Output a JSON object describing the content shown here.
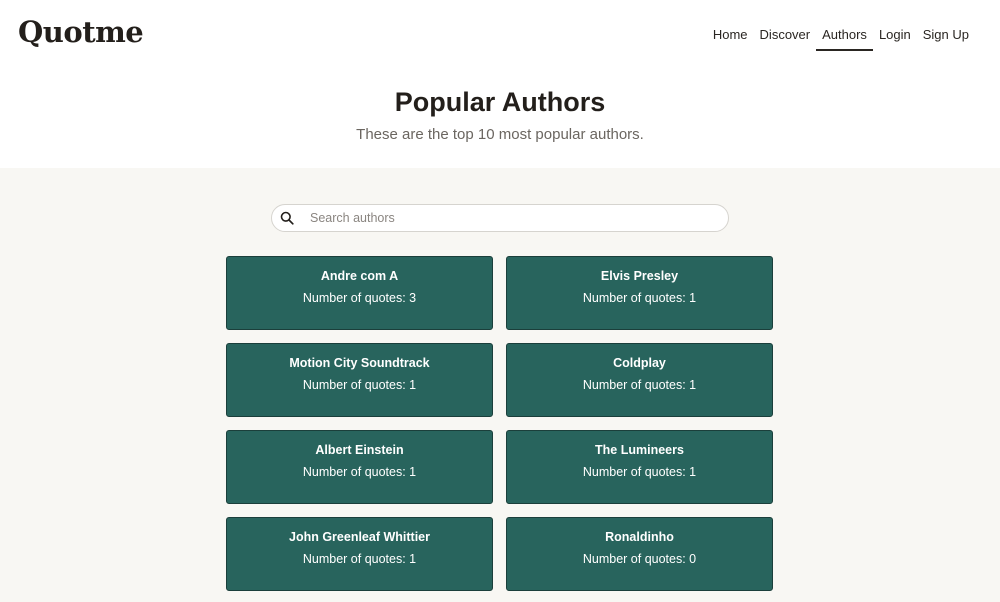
{
  "app": {
    "logo": "Quotme"
  },
  "nav": {
    "items": [
      "Home",
      "Discover",
      "Authors",
      "Login",
      "Sign Up"
    ],
    "active": "Authors"
  },
  "hero": {
    "title": "Popular Authors",
    "subtitle": "These are the top 10 most popular authors."
  },
  "search": {
    "placeholder": "Search authors",
    "value": ""
  },
  "authors": [
    {
      "name": "Andre com A",
      "count_text": "Number of quotes: 3"
    },
    {
      "name": "Elvis Presley",
      "count_text": "Number of quotes: 1"
    },
    {
      "name": "Motion City Soundtrack",
      "count_text": "Number of quotes: 1"
    },
    {
      "name": "Coldplay",
      "count_text": "Number of quotes: 1"
    },
    {
      "name": "Albert Einstein",
      "count_text": "Number of quotes: 1"
    },
    {
      "name": "The Lumineers",
      "count_text": "Number of quotes: 1"
    },
    {
      "name": "John Greenleaf Whittier",
      "count_text": "Number of quotes: 1"
    },
    {
      "name": "Ronaldinho",
      "count_text": "Number of quotes: 0"
    }
  ],
  "colors": {
    "card_bg": "#28645d",
    "page_bg": "#f8f7f3",
    "text_dark": "#231f1b"
  },
  "icons": {
    "search": "search-icon"
  }
}
